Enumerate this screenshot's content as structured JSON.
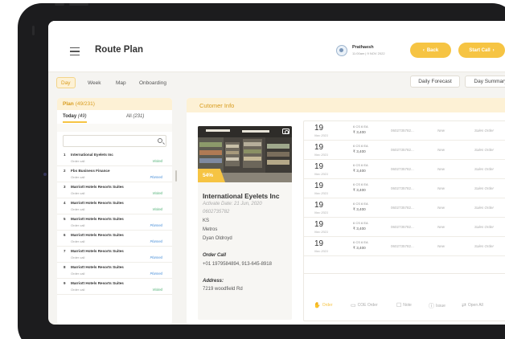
{
  "header": {
    "title": "Route Plan",
    "user_name": "Prathaesh",
    "user_time": "11:00am | 9 NOV 2022",
    "back_label": "Back",
    "start_call_label": "Start Call"
  },
  "tabs": [
    {
      "label": "Day",
      "active": true
    },
    {
      "label": "Week",
      "active": false
    },
    {
      "label": "Map",
      "active": false
    },
    {
      "label": "Onboarding",
      "active": false
    }
  ],
  "actions": {
    "daily_forecast": "Daily Forecast",
    "day_summary": "Day Summary"
  },
  "plan": {
    "title": "Plan",
    "count": "(49/231)",
    "today_label": "Today",
    "today_count": "(49)",
    "all_label": "All",
    "all_count": "(231)",
    "search_placeholder": "",
    "items": [
      {
        "num": "1",
        "name": "International Eyelets Inc",
        "type": "Order call",
        "status": "Visited"
      },
      {
        "num": "2",
        "name": "Fbs Business Finance",
        "type": "Order call",
        "status": "Planned"
      },
      {
        "num": "3",
        "name": "Marriott Hotels Resorts Suites",
        "type": "Order call",
        "status": "Visited"
      },
      {
        "num": "4",
        "name": "Marriott Hotels Resorts Suites",
        "type": "Order call",
        "status": "Visited"
      },
      {
        "num": "5",
        "name": "Marriott Hotels Resorts Suites",
        "type": "Order call",
        "status": "Planned"
      },
      {
        "num": "6",
        "name": "Marriott Hotels Resorts Suites",
        "type": "Order call",
        "status": "Planned"
      },
      {
        "num": "7",
        "name": "Marriott Hotels Resorts Suites",
        "type": "Order call",
        "status": "Planned"
      },
      {
        "num": "8",
        "name": "Marriott Hotels Resorts Suites",
        "type": "Order call",
        "status": "Planned"
      },
      {
        "num": "9",
        "name": "Marriott Hotels Resorts Suites",
        "type": "Order call",
        "status": "Visited"
      }
    ]
  },
  "customer": {
    "panel_title": "Cutomer Info",
    "progress_percent": 54,
    "progress_label": "54%",
    "name": "International Eyelets Inc",
    "activate_date": "Activate Date: 21 Jun, 2020",
    "phone": "0602735782",
    "state": "KS",
    "city": "Metros",
    "contact": "Dyan Oldroyd",
    "call_label": "Order Call",
    "call_numbers": "+01 1979584894, 913-645-8918",
    "address_label": "Address:",
    "address": "7219 woodfield Rd"
  },
  "orders": [
    {
      "day": "19",
      "month": "Nov 2021",
      "code": "6 CS 6 EA",
      "amount": "₹ 3,400",
      "phone": "0602735782...",
      "state": "New",
      "type": "Sales Order"
    },
    {
      "day": "19",
      "month": "Nov 2021",
      "code": "6 CS 6 EA",
      "amount": "₹ 3,400",
      "phone": "0602735782...",
      "state": "New",
      "type": "Sales Order"
    },
    {
      "day": "19",
      "month": "Nov 2021",
      "code": "6 CS 6 EA",
      "amount": "₹ 3,400",
      "phone": "0602735782...",
      "state": "New",
      "type": "Sales Order"
    },
    {
      "day": "19",
      "month": "Nov 2021",
      "code": "6 CS 6 EA",
      "amount": "₹ 3,400",
      "phone": "0602735782...",
      "state": "New",
      "type": "Sales Order"
    },
    {
      "day": "19",
      "month": "Nov 2021",
      "code": "6 CS 6 EA",
      "amount": "₹ 3,400",
      "phone": "0602735782...",
      "state": "New",
      "type": "Sales Order"
    },
    {
      "day": "19",
      "month": "Nov 2021",
      "code": "6 CS 6 EA",
      "amount": "₹ 3,400",
      "phone": "0602735782...",
      "state": "New",
      "type": "Sales Order"
    },
    {
      "day": "19",
      "month": "Nov 2021",
      "code": "6 CS 6 EA",
      "amount": "₹ 3,400",
      "phone": "0602735782...",
      "state": "New",
      "type": "Sales Order"
    }
  ],
  "order_actions": [
    {
      "label": "Order",
      "icon": "hand-icon",
      "glyph": "✋",
      "active": true
    },
    {
      "label": "COE Order",
      "icon": "cart-icon",
      "glyph": "▭",
      "active": false
    },
    {
      "label": "Note",
      "icon": "note-icon",
      "glyph": "☐",
      "active": false
    },
    {
      "label": "Issue",
      "icon": "info-icon",
      "glyph": "ⓘ",
      "active": false
    },
    {
      "label": "Open All",
      "icon": "expand-icon",
      "glyph": "⇄",
      "active": false
    }
  ],
  "colors": {
    "accent": "#f6c443",
    "accent_text": "#d89c1e",
    "accent_bg": "#fdf1d5",
    "visited": "#4caf72",
    "planned": "#4a90d9",
    "bezel": "#1c1c1e"
  }
}
